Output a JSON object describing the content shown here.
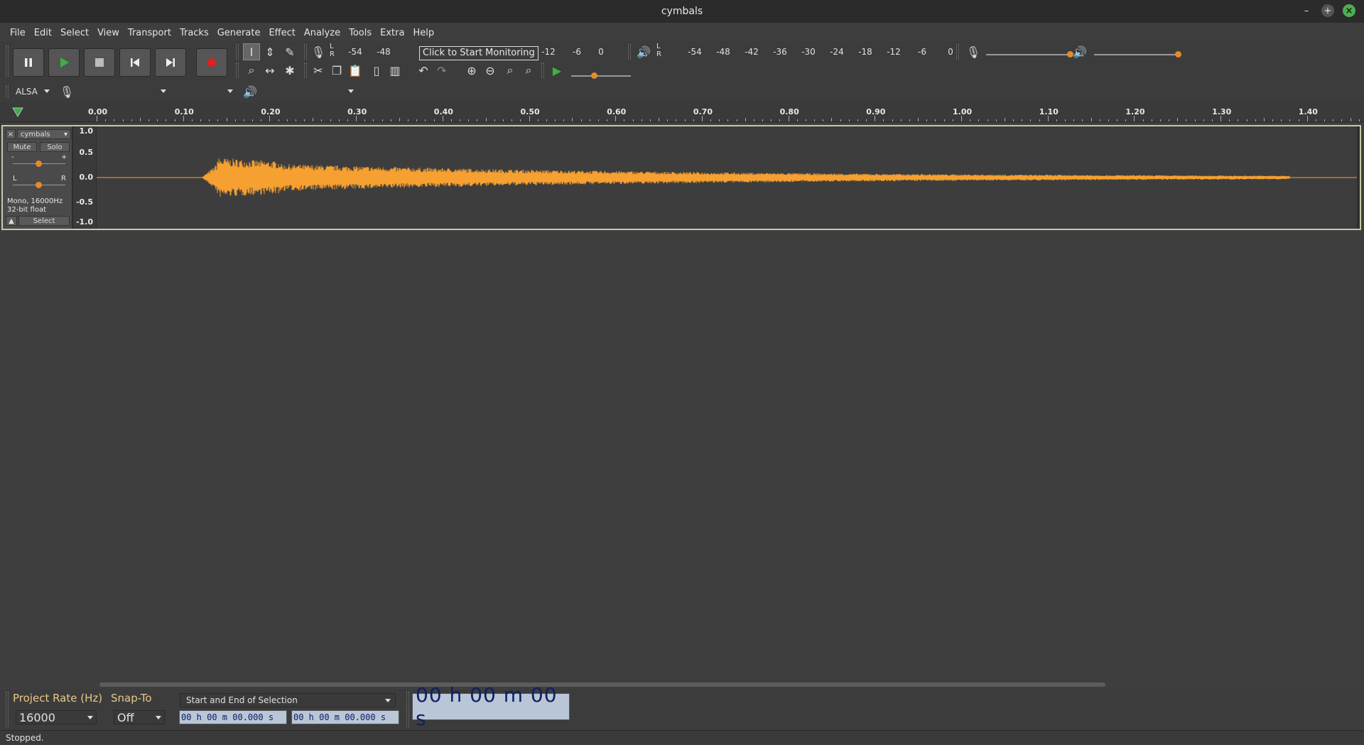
{
  "window": {
    "title": "cymbals"
  },
  "menu": [
    "File",
    "Edit",
    "Select",
    "View",
    "Transport",
    "Tracks",
    "Generate",
    "Effect",
    "Analyze",
    "Tools",
    "Extra",
    "Help"
  ],
  "meters": {
    "record": {
      "ticks_left": [
        "-54",
        "-48"
      ],
      "ticks_right": [
        "-12",
        "-6",
        "0"
      ],
      "tooltip": "Click to Start Monitoring",
      "channel_l": "L",
      "channel_r": "R"
    },
    "playback": {
      "ticks": [
        "-54",
        "-48",
        "-42",
        "-36",
        "-30",
        "-24",
        "-18",
        "-12",
        "-6",
        "0"
      ],
      "channel_l": "L",
      "channel_r": "R"
    }
  },
  "device": {
    "host": "ALSA",
    "record_device": "",
    "channels": "",
    "playback_device": ""
  },
  "ruler": {
    "ticks": [
      "0.00",
      "0.10",
      "0.20",
      "0.30",
      "0.40",
      "0.50",
      "0.60",
      "0.70",
      "0.80",
      "0.90",
      "1.00",
      "1.10",
      "1.20",
      "1.30",
      "1.40"
    ]
  },
  "track": {
    "name": "cymbals",
    "mute_label": "Mute",
    "solo_label": "Solo",
    "gain_minus": "-",
    "gain_plus": "+",
    "pan_l": "L",
    "pan_r": "R",
    "info_line1": "Mono, 16000Hz",
    "info_line2": "32-bit float",
    "select_label": "Select",
    "scale": [
      "1.0",
      "0.5",
      "0.0",
      "-0.5",
      "-1.0"
    ],
    "colors": {
      "waveform": "#f5a030",
      "background": "#3d3d3d"
    }
  },
  "bottom": {
    "project_rate_label": "Project Rate (Hz)",
    "snap_to_label": "Snap-To",
    "project_rate_value": "16000",
    "snap_to_value": "Off",
    "selection_mode": "Start and End of Selection",
    "selection_start": "00 h 00 m 00.000 s",
    "selection_end": "00 h 00 m 00.000 s",
    "audio_position": "00 h 00 m 00 s"
  },
  "status": {
    "text": "Stopped."
  }
}
